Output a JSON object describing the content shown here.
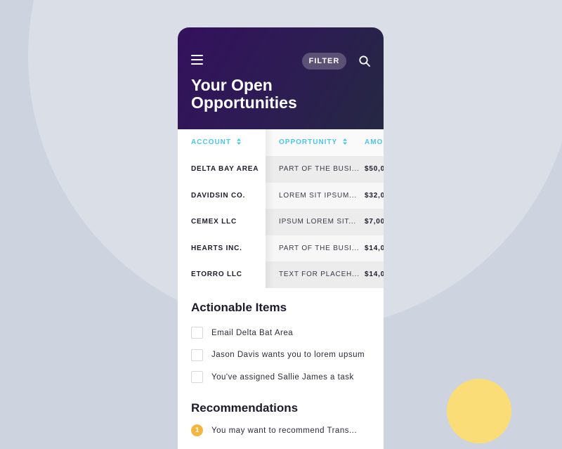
{
  "header": {
    "filter_label": "FILTER",
    "title": "Your Open Opportunities"
  },
  "table": {
    "columns": {
      "account": "ACCOUNT",
      "opportunity": "OPPORTUNITY",
      "amount": "AMOU"
    },
    "rows": [
      {
        "account": "DELTA BAY AREA",
        "opportunity": "PART OF THE BUSI...",
        "amount": "$50,0"
      },
      {
        "account": "DAVIDSIN CO.",
        "opportunity": "LOREM SIT IPSUM...",
        "amount": "$32,0"
      },
      {
        "account": "CEMEX LLC",
        "opportunity": "IPSUM LOREM SIT...",
        "amount": "$7,00"
      },
      {
        "account": "HEARTS INC.",
        "opportunity": "PART OF THE BUSI...",
        "amount": "$14,0"
      },
      {
        "account": "ETORRO LLC",
        "opportunity": "TEXT FOR PLACEH...",
        "amount": "$14,0"
      }
    ]
  },
  "actionable": {
    "title": "Actionable Items",
    "items": [
      "Email Delta Bat Area",
      "Jason Davis wants you to lorem upsum",
      "You've assigned Sallie James a task"
    ]
  },
  "recommendations": {
    "title": "Recommendations",
    "items": [
      {
        "badge": "1",
        "text": "You may want to recommend Trans..."
      }
    ]
  },
  "colors": {
    "page_background": "#cdd3df",
    "header_gradient_start": "#34115d",
    "header_gradient_end": "#252842",
    "accent_cyan": "#4cc6e8",
    "badge_orange": "#f5b640",
    "decor_yellow": "#fbdd78"
  },
  "icons": [
    "hamburger-menu-icon",
    "search-icon",
    "sort-arrows-icon"
  ]
}
